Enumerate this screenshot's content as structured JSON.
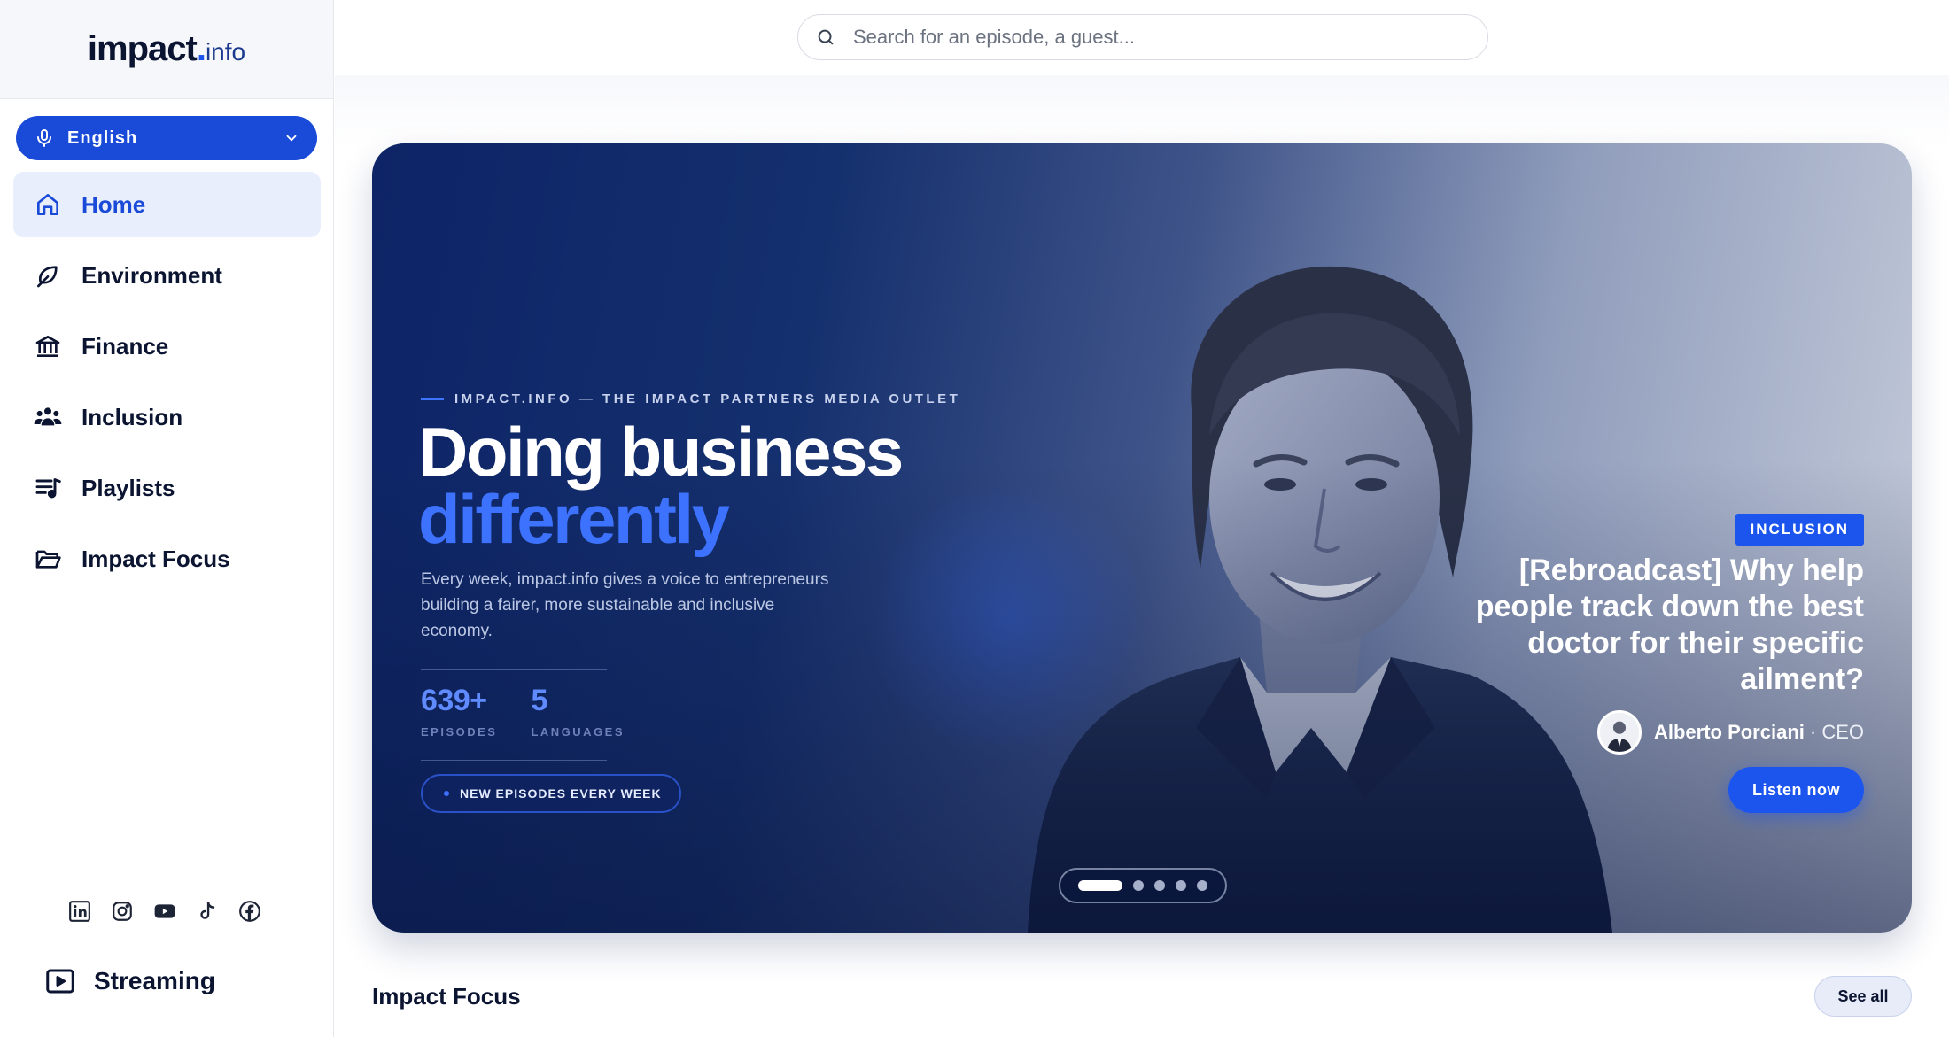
{
  "brand": {
    "logo_main": "impact",
    "logo_dot": ".",
    "logo_suffix": "info"
  },
  "language": {
    "label": "English"
  },
  "nav": [
    {
      "label": "Home",
      "icon": "home-icon",
      "active": true
    },
    {
      "label": "Environment",
      "icon": "leaf-icon"
    },
    {
      "label": "Finance",
      "icon": "bank-icon"
    },
    {
      "label": "Inclusion",
      "icon": "people-icon"
    },
    {
      "label": "Playlists",
      "icon": "playlist-icon"
    },
    {
      "label": "Impact Focus",
      "icon": "folder-icon"
    }
  ],
  "socials": [
    "linkedin-icon",
    "instagram-icon",
    "youtube-icon",
    "tiktok-icon",
    "facebook-icon"
  ],
  "streaming": {
    "label": "Streaming"
  },
  "search": {
    "placeholder": "Search for an episode, a guest..."
  },
  "hero": {
    "kicker": "IMPACT.INFO — THE IMPACT PARTNERS MEDIA OUTLET",
    "headline_1": "Doing business",
    "headline_2": "differently",
    "lead": "Every week, impact.info gives a voice to entrepreneurs building a fairer, more sustainable and inclusive economy.",
    "stats": [
      {
        "value": "639+",
        "label": "EPISODES"
      },
      {
        "value": "5",
        "label": "LANGUAGES"
      }
    ],
    "badge": "NEW EPISODES EVERY WEEK",
    "featured": {
      "category": "INCLUSION",
      "title": "[Rebroadcast] Why help people track down the best doctor for their specific ailment?",
      "guest_name": "Alberto Porciani",
      "guest_role": "· CEO",
      "cta": "Listen now"
    },
    "pager": {
      "total": 5,
      "active": 1
    }
  },
  "section": {
    "title": "Impact Focus",
    "see_all": "See all"
  },
  "colors": {
    "accent": "#1b55ee",
    "navy": "#0d2466",
    "active_bg": "#e8eefc"
  }
}
